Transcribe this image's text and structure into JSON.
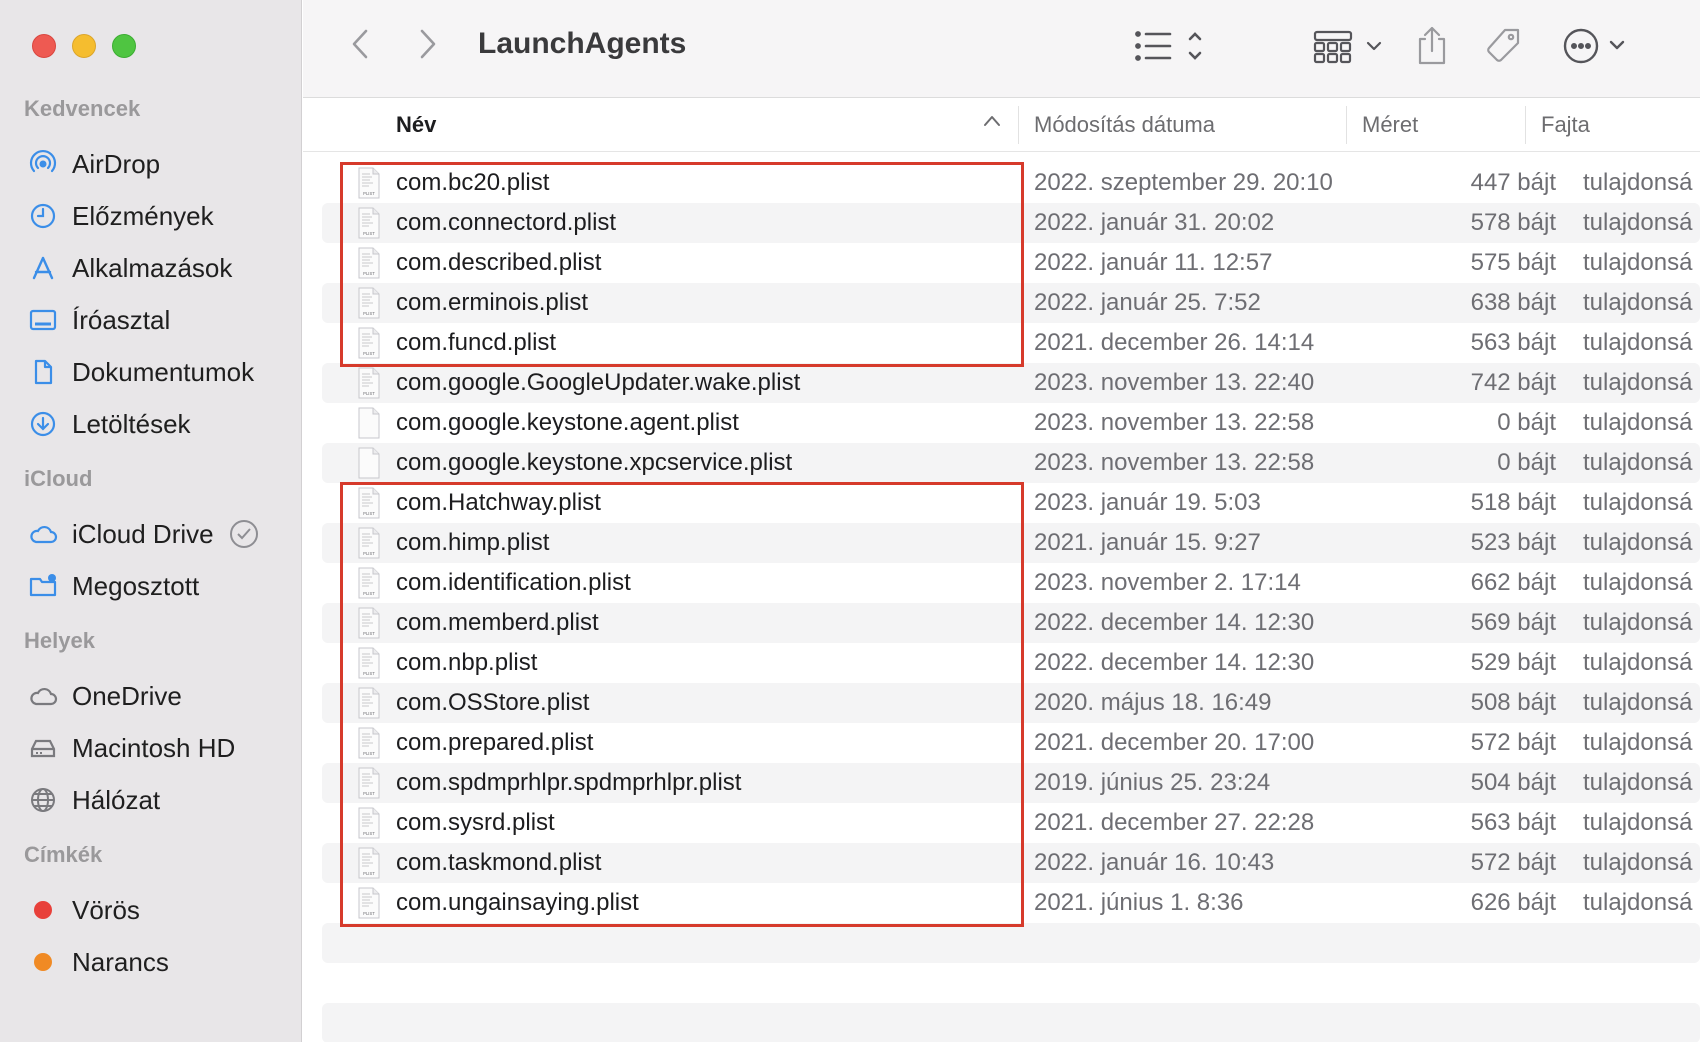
{
  "window": {
    "title": "LaunchAgents"
  },
  "sidebar": {
    "sections": [
      {
        "label": "Kedvencek"
      },
      {
        "label": "iCloud"
      },
      {
        "label": "Helyek"
      },
      {
        "label": "Címkék"
      }
    ],
    "favorites": [
      {
        "label": "AirDrop",
        "icon": "airdrop-icon"
      },
      {
        "label": "Előzmények",
        "icon": "clock-icon"
      },
      {
        "label": "Alkalmazások",
        "icon": "applications-icon"
      },
      {
        "label": "Íróasztal",
        "icon": "desktop-icon"
      },
      {
        "label": "Dokumentumok",
        "icon": "document-icon"
      },
      {
        "label": "Letöltések",
        "icon": "download-icon"
      }
    ],
    "icloud": [
      {
        "label": "iCloud Drive",
        "icon": "cloud-icon"
      },
      {
        "label": "Megosztott",
        "icon": "shared-folder-icon"
      }
    ],
    "places": [
      {
        "label": "OneDrive",
        "icon": "cloud-icon"
      },
      {
        "label": "Macintosh HD",
        "icon": "drive-icon"
      },
      {
        "label": "Hálózat",
        "icon": "globe-icon"
      }
    ],
    "tags": [
      {
        "label": "Vörös",
        "color": "#e8403a"
      },
      {
        "label": "Narancs",
        "color": "#f08a24"
      }
    ]
  },
  "columns": {
    "name": "Név",
    "modified": "Módosítás dátuma",
    "size": "Méret",
    "kind": "Fajta"
  },
  "files": [
    {
      "name": "com.bc20.plist",
      "date": "2022. szeptember 29. 20:10",
      "size": "447 bájt",
      "kind": "tulajdonsá",
      "icon": "plist"
    },
    {
      "name": "com.connectord.plist",
      "date": "2022. január 31. 20:02",
      "size": "578 bájt",
      "kind": "tulajdonsá",
      "icon": "plist"
    },
    {
      "name": "com.described.plist",
      "date": "2022. január 11. 12:57",
      "size": "575 bájt",
      "kind": "tulajdonsá",
      "icon": "plist"
    },
    {
      "name": "com.erminois.plist",
      "date": "2022. január 25. 7:52",
      "size": "638 bájt",
      "kind": "tulajdonsá",
      "icon": "plist"
    },
    {
      "name": "com.funcd.plist",
      "date": "2021. december 26. 14:14",
      "size": "563 bájt",
      "kind": "tulajdonsá",
      "icon": "plist"
    },
    {
      "name": "com.google.GoogleUpdater.wake.plist",
      "date": "2023. november 13. 22:40",
      "size": "742 bájt",
      "kind": "tulajdonsá",
      "icon": "plist"
    },
    {
      "name": "com.google.keystone.agent.plist",
      "date": "2023. november 13. 22:58",
      "size": "0 bájt",
      "kind": "tulajdonsá",
      "icon": "blank"
    },
    {
      "name": "com.google.keystone.xpcservice.plist",
      "date": "2023. november 13. 22:58",
      "size": "0 bájt",
      "kind": "tulajdonsá",
      "icon": "blank"
    },
    {
      "name": "com.Hatchway.plist",
      "date": "2023. január 19. 5:03",
      "size": "518 bájt",
      "kind": "tulajdonsá",
      "icon": "plist"
    },
    {
      "name": "com.himp.plist",
      "date": "2021. január 15. 9:27",
      "size": "523 bájt",
      "kind": "tulajdonsá",
      "icon": "plist"
    },
    {
      "name": "com.identification.plist",
      "date": "2023. november 2. 17:14",
      "size": "662 bájt",
      "kind": "tulajdonsá",
      "icon": "plist"
    },
    {
      "name": "com.memberd.plist",
      "date": "2022. december 14. 12:30",
      "size": "569 bájt",
      "kind": "tulajdonsá",
      "icon": "plist"
    },
    {
      "name": "com.nbp.plist",
      "date": "2022. december 14. 12:30",
      "size": "529 bájt",
      "kind": "tulajdonsá",
      "icon": "plist"
    },
    {
      "name": "com.OSStore.plist",
      "date": "2020. május 18. 16:49",
      "size": "508 bájt",
      "kind": "tulajdonsá",
      "icon": "plist"
    },
    {
      "name": "com.prepared.plist",
      "date": "2021. december 20. 17:00",
      "size": "572 bájt",
      "kind": "tulajdonsá",
      "icon": "plist"
    },
    {
      "name": "com.spdmprhlpr.spdmprhlpr.plist",
      "date": "2019. június 25. 23:24",
      "size": "504 bájt",
      "kind": "tulajdonsá",
      "icon": "plist"
    },
    {
      "name": "com.sysrd.plist",
      "date": "2021. december 27. 22:28",
      "size": "563 bájt",
      "kind": "tulajdonsá",
      "icon": "plist"
    },
    {
      "name": "com.taskmond.plist",
      "date": "2022. január 16. 10:43",
      "size": "572 bájt",
      "kind": "tulajdonsá",
      "icon": "plist"
    },
    {
      "name": "com.ungainsaying.plist",
      "date": "2021. június 1. 8:36",
      "size": "626 bájt",
      "kind": "tulajdonsá",
      "icon": "plist"
    }
  ],
  "highlight_color": "#d63a2b",
  "file_icon_label": "PLIST"
}
